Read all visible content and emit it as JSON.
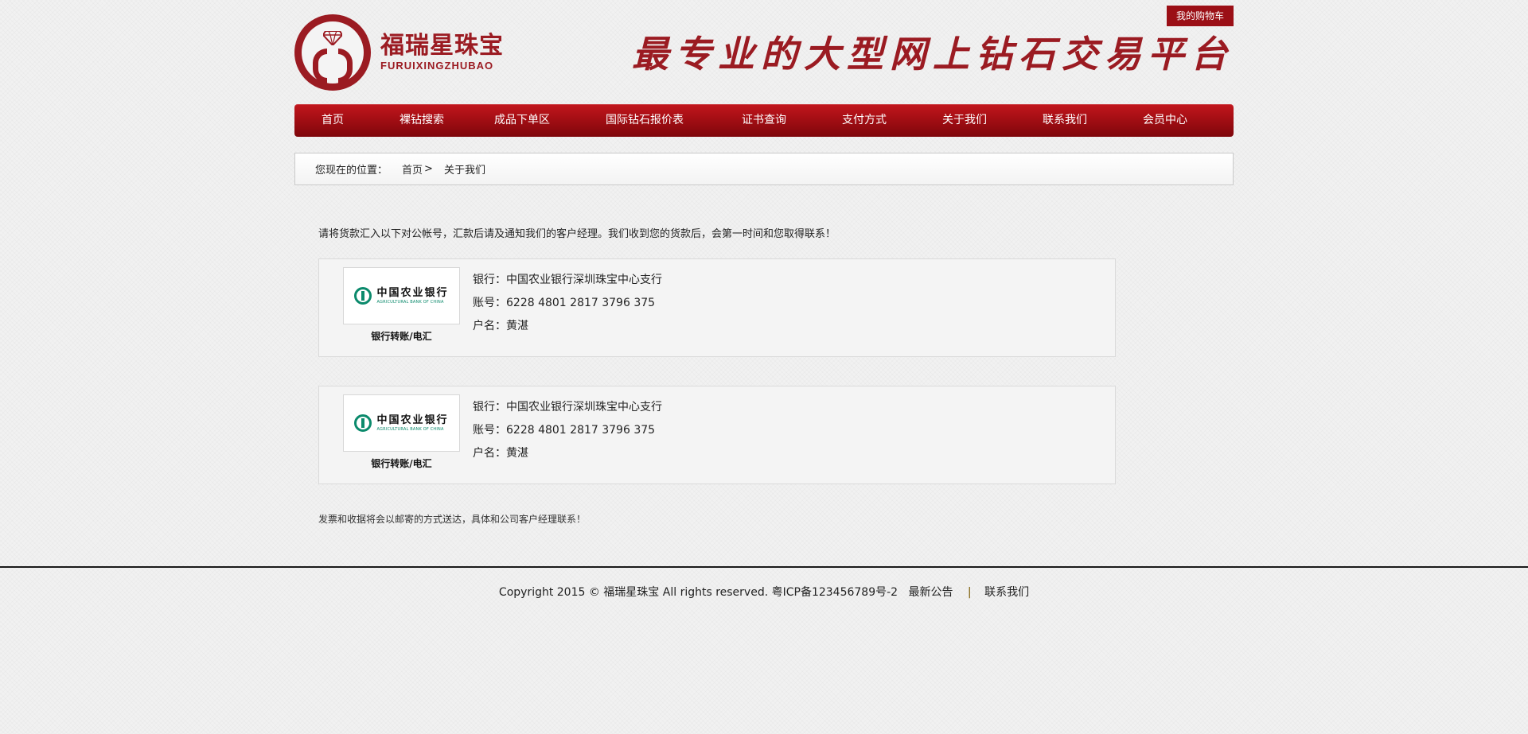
{
  "header": {
    "logo_cn": "福瑞星珠宝",
    "logo_en": "FURUIXINGZHUBAO",
    "cart_label": "我的购物车",
    "slogan": "最专业的大型网上钻石交易平台"
  },
  "nav": {
    "items": [
      {
        "label": "首页"
      },
      {
        "label": "裸钻搜索"
      },
      {
        "label": "成品下单区"
      },
      {
        "label": "国际钻石报价表"
      },
      {
        "label": "证书查询"
      },
      {
        "label": "支付方式"
      },
      {
        "label": "关于我们"
      },
      {
        "label": "联系我们"
      },
      {
        "label": "会员中心"
      }
    ]
  },
  "breadcrumb": {
    "label": "您现在的位置：",
    "home": "首页",
    "separator": ">",
    "current": "关于我们"
  },
  "content": {
    "intro": "请将货款汇入以下对公帐号，汇款后请及通知我们的客户经理。我们收到您的货款后，会第一时间和您取得联系！",
    "banks": [
      {
        "logo_cn": "中国农业银行",
        "logo_en": "AGRICULTURAL BANK OF CHINA",
        "caption": "银行转账/电汇",
        "bank_line": "银行：中国农业银行深圳珠宝中心支行",
        "account_line": "账号：6228 4801 2817 3796 375",
        "holder_line": "户名：黄湛"
      },
      {
        "logo_cn": "中国农业银行",
        "logo_en": "AGRICULTURAL BANK OF CHINA",
        "caption": "银行转账/电汇",
        "bank_line": "银行：中国农业银行深圳珠宝中心支行",
        "account_line": "账号：6228 4801 2817 3796 375",
        "holder_line": "户名：黄湛"
      }
    ],
    "note": "发票和收据将会以邮寄的方式送达，具体和公司客户经理联系！"
  },
  "footer": {
    "copyright": "Copyright 2015 © 福瑞星珠宝 All rights reserved. 粤ICP备123456789号-2",
    "announcement": "最新公告",
    "separator": "|",
    "contact": "联系我们"
  },
  "colors": {
    "brand_red": "#9b1b22",
    "nav_top": "#c2161d",
    "nav_bottom": "#7e060b",
    "bank_green": "#0b8a6c"
  }
}
